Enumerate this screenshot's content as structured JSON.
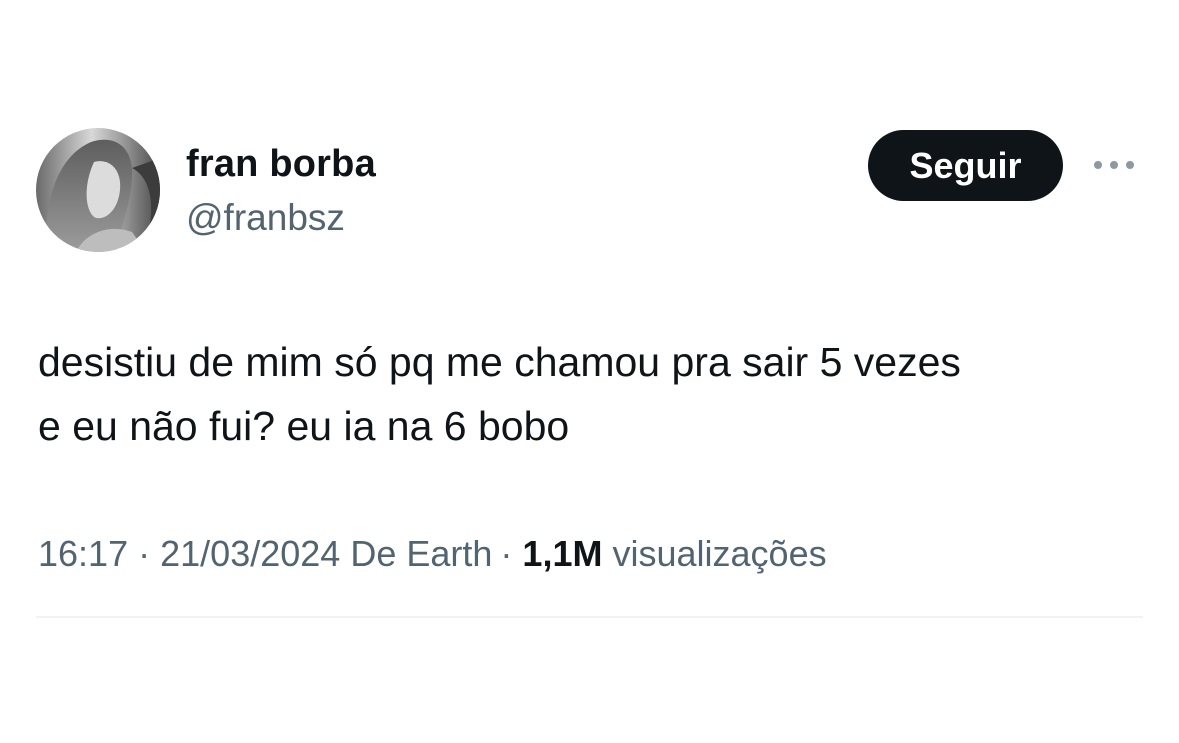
{
  "author": {
    "display_name": "fran borba",
    "handle": "@franbsz"
  },
  "header": {
    "follow_label": "Seguir",
    "more_icon": "more-horizontal-icon"
  },
  "tweet": {
    "text": "desistiu de mim só pq me chamou pra sair 5 vezes\ne eu não fui? eu ia na 6 bobo"
  },
  "meta": {
    "time": "16:17",
    "separator": "·",
    "date": "21/03/2024",
    "source": "De Earth",
    "views_count": "1,1M",
    "views_label": "visualizações"
  },
  "colors": {
    "text_primary": "#0f1419",
    "text_secondary": "#536471",
    "button_bg": "#0f1419",
    "divider": "#eff3f4"
  }
}
